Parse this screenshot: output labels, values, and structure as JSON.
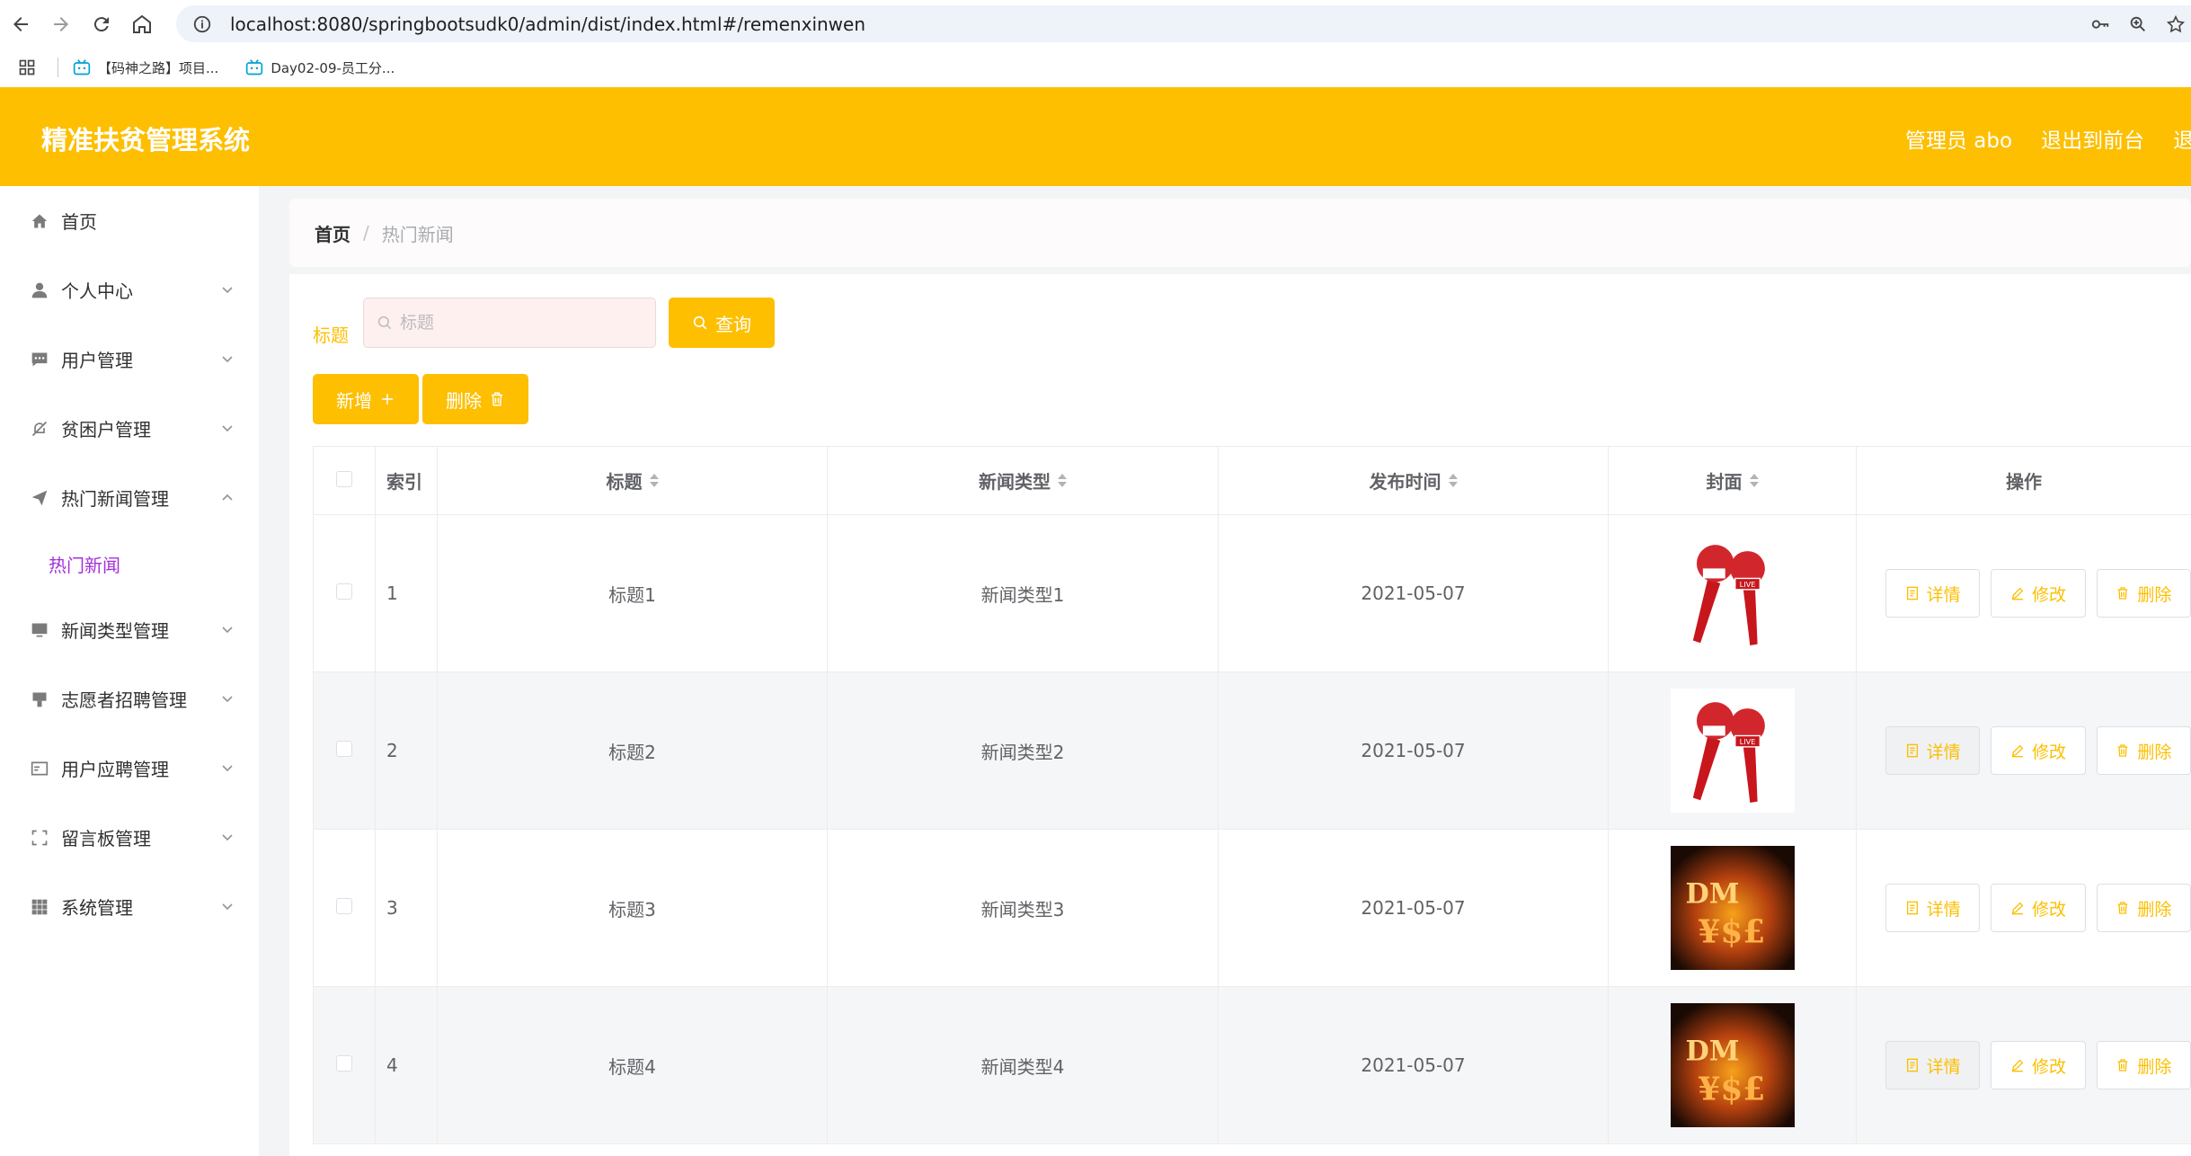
{
  "browser": {
    "url_host": "localhost",
    "url_rest": ":8080/springbootsudk0/admin/dist/index.html#/remenxinwen",
    "bookmarks": [
      {
        "label": "【码神之路】项目..."
      },
      {
        "label": "Day02-09-员工分..."
      }
    ]
  },
  "header": {
    "title": "精准扶贫管理系统",
    "admin_label": "管理员 abo",
    "front_link": "退出到前台",
    "logout_link": "退出登录"
  },
  "sidebar": {
    "items": [
      {
        "label": "首页",
        "icon": "home-icon"
      },
      {
        "label": "个人中心",
        "icon": "user-icon"
      },
      {
        "label": "用户管理",
        "icon": "chat-icon"
      },
      {
        "label": "贫困户管理",
        "icon": "bell-off-icon"
      },
      {
        "label": "热门新闻管理",
        "icon": "send-icon"
      },
      {
        "label": "新闻类型管理",
        "icon": "monitor-icon"
      },
      {
        "label": "志愿者招聘管理",
        "icon": "printer-icon"
      },
      {
        "label": "用户应聘管理",
        "icon": "id-card-icon"
      },
      {
        "label": "留言板管理",
        "icon": "fullscreen-icon"
      },
      {
        "label": "系统管理",
        "icon": "grid-icon"
      }
    ],
    "sub_item": "热门新闻"
  },
  "breadcrumb": {
    "home": "首页",
    "separator": "/",
    "current": "热门新闻"
  },
  "search": {
    "label": "标题",
    "placeholder": "标题",
    "button": "查询"
  },
  "actions": {
    "add": "新增",
    "delete": "删除"
  },
  "table": {
    "headers": {
      "index": "索引",
      "title": "标题",
      "type": "新闻类型",
      "date": "发布时间",
      "cover": "封面",
      "ops": "操作"
    },
    "rows": [
      {
        "index": "1",
        "title": "标题1",
        "type": "新闻类型1",
        "date": "2021-05-07",
        "cover": "microphone-news-image"
      },
      {
        "index": "2",
        "title": "标题2",
        "type": "新闻类型2",
        "date": "2021-05-07",
        "cover": "microphone-news-image"
      },
      {
        "index": "3",
        "title": "标题3",
        "type": "新闻类型3",
        "date": "2021-05-07",
        "cover": "money-fire-image"
      },
      {
        "index": "4",
        "title": "标题4",
        "type": "新闻类型4",
        "date": "2021-05-07",
        "cover": "money-fire-image"
      }
    ],
    "ops": {
      "detail": "详情",
      "edit": "修改",
      "delete": "删除"
    }
  },
  "colors": {
    "accent": "#fdbf00",
    "submenu_active": "#a431d9",
    "background": "#f3f4f6"
  }
}
